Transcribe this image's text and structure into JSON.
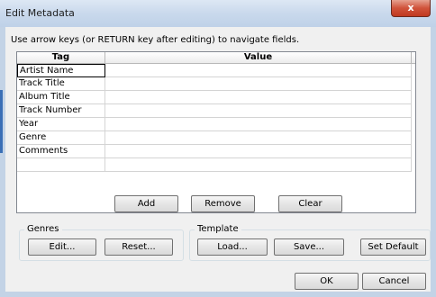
{
  "window": {
    "title": "Edit Metadata",
    "close_glyph": "x"
  },
  "instruction": "Use arrow keys (or RETURN key after editing) to navigate fields.",
  "grid": {
    "columns": [
      "Tag",
      "Value"
    ],
    "rows": [
      {
        "tag": "Artist Name",
        "value": ""
      },
      {
        "tag": "Track Title",
        "value": ""
      },
      {
        "tag": "Album Title",
        "value": ""
      },
      {
        "tag": "Track Number",
        "value": ""
      },
      {
        "tag": "Year",
        "value": ""
      },
      {
        "tag": "Genre",
        "value": ""
      },
      {
        "tag": "Comments",
        "value": ""
      },
      {
        "tag": "",
        "value": ""
      }
    ]
  },
  "actions": {
    "add": "Add",
    "remove": "Remove",
    "clear": "Clear"
  },
  "genres": {
    "label": "Genres",
    "edit": "Edit...",
    "reset": "Reset..."
  },
  "template": {
    "label": "Template",
    "load": "Load...",
    "save": "Save...",
    "set_default": "Set Default"
  },
  "dialog": {
    "ok": "OK",
    "cancel": "Cancel"
  }
}
